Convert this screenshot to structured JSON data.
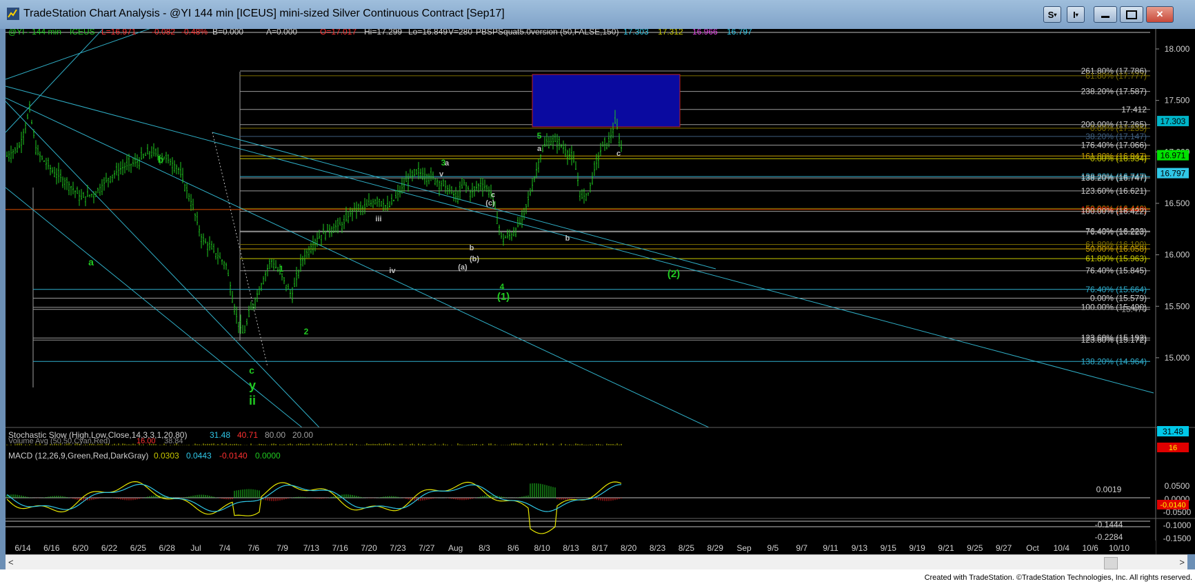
{
  "window": {
    "title": "TradeStation Chart Analysis - @YI 144 min [ICEUS] mini-sized Silver Continuous Contract [Sep17]",
    "buttons": {
      "s": "S",
      "i": "I"
    }
  },
  "header": {
    "symbol": "@YI - 144 min",
    "exchange": "ICEUS",
    "last": "L=16.971",
    "change": "-0.082",
    "change_pct": "-0.48%",
    "bid": "B=0.000",
    "ask": "A=0.000",
    "open": "O=17.017",
    "high": "Hi=17.299",
    "low": "Lo=16.849",
    "volume": "V=280",
    "study": "PBSPSquat5.0version (50,FALSE,150)",
    "study_values": [
      "17.303",
      "17.312",
      "16.966",
      "16.797"
    ]
  },
  "price_axis": {
    "ticks": [
      "18.000",
      "17.500",
      "17.000",
      "16.500",
      "16.000",
      "15.500",
      "15.000"
    ],
    "badges": [
      {
        "value": "17.303",
        "bg": "#00b4c8",
        "fg": "#000000"
      },
      {
        "value": "16.971",
        "bg": "#00e000",
        "fg": "#000000"
      },
      {
        "value": "16.797",
        "bg": "#30c8e8",
        "fg": "#000000"
      }
    ]
  },
  "fib_labels": [
    {
      "price": 17.786,
      "text": "261.80% (17.786)",
      "color": "#d0d0d0"
    },
    {
      "price": 17.74,
      "text": "61.80% (17.777)",
      "color": "#807000"
    },
    {
      "price": 17.587,
      "text": "238.20% (17.587)",
      "color": "#d0d0d0"
    },
    {
      "price": 17.412,
      "text": "17.412",
      "color": "#d0d0d0"
    },
    {
      "price": 17.265,
      "text": "200.00% (17.265)",
      "color": "#d0d0d0"
    },
    {
      "price": 17.23,
      "text": "0.00% (17.235)",
      "color": "#807000"
    },
    {
      "price": 17.15,
      "text": "38.20% (17.147)",
      "color": "#406080"
    },
    {
      "price": 17.066,
      "text": "176.40% (17.066)",
      "color": "#d0d0d0"
    },
    {
      "price": 16.96,
      "text": "161.80% (16.947)",
      "color": "#c8a000"
    },
    {
      "price": 16.934,
      "text": "0.00% (16.934)",
      "color": "#c8c800"
    },
    {
      "price": 16.76,
      "text": "138.20% (16.747)",
      "color": "#30b0d0"
    },
    {
      "price": 16.747,
      "text": "138.20% (16.747)",
      "color": "#d0d0d0"
    },
    {
      "price": 16.621,
      "text": "123.60% (16.621)",
      "color": "#d0d0d0"
    },
    {
      "price": 16.45,
      "text": "50.00% (16.440)",
      "color": "#807000"
    },
    {
      "price": 16.44,
      "text": "100.00% (16.440)",
      "color": "#ff2000"
    },
    {
      "price": 16.422,
      "text": "100.00% (16.422)",
      "color": "#d0d0d0"
    },
    {
      "price": 16.23,
      "text": "76.40% (16.223)",
      "color": "#d0d0d0"
    },
    {
      "price": 16.223,
      "text": "76.40% (16.223)",
      "color": "#a0a0a0"
    },
    {
      "price": 16.1,
      "text": "61.80% (16.100)",
      "color": "#807000"
    },
    {
      "price": 16.058,
      "text": "50.00% (16.058)",
      "color": "#c8a000"
    },
    {
      "price": 15.963,
      "text": "61.80% (15.963)",
      "color": "#c8c800"
    },
    {
      "price": 15.845,
      "text": "76.40% (15.845)",
      "color": "#d0d0d0"
    },
    {
      "price": 15.664,
      "text": "76.40% (15.664)",
      "color": "#30b0d0"
    },
    {
      "price": 15.579,
      "text": "0.00% (15.579)",
      "color": "#d0d0d0"
    },
    {
      "price": 15.49,
      "text": "100.00% (15.490)",
      "color": "#d0d0d0"
    },
    {
      "price": 15.47,
      "text": "15.470",
      "color": "#a0a0a0"
    },
    {
      "price": 15.192,
      "text": "123.60% (15.192)",
      "color": "#d0d0d0"
    },
    {
      "price": 15.172,
      "text": "123.60% (15.172)",
      "color": "#d0d0d0"
    },
    {
      "price": 14.964,
      "text": "138.20% (14.964)",
      "color": "#30b0d0"
    }
  ],
  "wave_labels": [
    {
      "text": "b",
      "color": "#20c820",
      "size": 14
    },
    {
      "text": "a",
      "color": "#20c820",
      "size": 14
    },
    {
      "text": "c",
      "color": "#20c820",
      "size": 14
    },
    {
      "text": "y",
      "color": "#20c820",
      "size": 18
    },
    {
      "text": "ii",
      "color": "#20c820",
      "size": 18
    },
    {
      "text": "1",
      "color": "#20c820",
      "size": 12
    },
    {
      "text": "2",
      "color": "#20c820",
      "size": 12
    },
    {
      "text": "iii",
      "color": "#c0c0c0",
      "size": 11
    },
    {
      "text": "iv",
      "color": "#c0c0c0",
      "size": 11
    },
    {
      "text": "v",
      "color": "#c0c0c0",
      "size": 11
    },
    {
      "text": "3",
      "color": "#20c820",
      "size": 12
    },
    {
      "text": "a",
      "color": "#c0c0c0",
      "size": 11
    },
    {
      "text": "(a)",
      "color": "#c0c0c0",
      "size": 11
    },
    {
      "text": "b",
      "color": "#c0c0c0",
      "size": 11
    },
    {
      "text": "(b)",
      "color": "#c0c0c0",
      "size": 11
    },
    {
      "text": "c",
      "color": "#c0c0c0",
      "size": 11
    },
    {
      "text": "(c)",
      "color": "#c0c0c0",
      "size": 11
    },
    {
      "text": "4",
      "color": "#20c820",
      "size": 12
    },
    {
      "text": "(1)",
      "color": "#20c820",
      "size": 15
    },
    {
      "text": "5",
      "color": "#20c820",
      "size": 12
    },
    {
      "text": "a",
      "color": "#c0c0c0",
      "size": 11
    },
    {
      "text": "b",
      "color": "#c0c0c0",
      "size": 11
    },
    {
      "text": "c",
      "color": "#c0c0c0",
      "size": 11
    },
    {
      "text": "(2)",
      "color": "#20c820",
      "size": 15
    }
  ],
  "indicators": {
    "stochastic": {
      "label": "Stochastic Slow (High,Low,Close,14,3,3,1,20,80)",
      "v1": "31.48",
      "v2": "40.71",
      "v3": "80.00",
      "v4": "20.00"
    },
    "volume_avg": {
      "label": "Volume Avg (50,50,Cyan,Red)",
      "v1": "16.00",
      "v2": "38.84"
    },
    "macd": {
      "label": "MACD (12,26,9,Green,Red,DarkGray)",
      "v1": "0.0303",
      "v2": "0.0443",
      "v3": "-0.0140",
      "v4": "0.0000"
    },
    "stoch_badge": "31.48",
    "vol_badge": "16",
    "macd_axis": [
      "0.0500",
      "0.0000",
      "-0.0500",
      "-0.1000",
      "-0.1500"
    ],
    "macd_labels": {
      "a": "0.0019",
      "b": "-0.1444",
      "c": "-0.2284",
      "badge": "-0.0140"
    }
  },
  "date_axis": [
    "6/14",
    "6/16",
    "6/20",
    "6/22",
    "6/25",
    "6/28",
    "Jul",
    "7/4",
    "7/6",
    "7/9",
    "7/13",
    "7/16",
    "7/20",
    "7/23",
    "7/27",
    "Aug",
    "8/3",
    "8/6",
    "8/10",
    "8/13",
    "8/17",
    "8/20",
    "8/23",
    "8/25",
    "8/29",
    "Sep",
    "9/5",
    "9/7",
    "9/11",
    "9/13",
    "9/15",
    "9/19",
    "9/21",
    "9/25",
    "9/27",
    "Oct",
    "10/4",
    "10/6",
    "10/10"
  ],
  "footer": "Created with TradeStation. ©TradeStation Technologies, Inc. All rights reserved."
}
